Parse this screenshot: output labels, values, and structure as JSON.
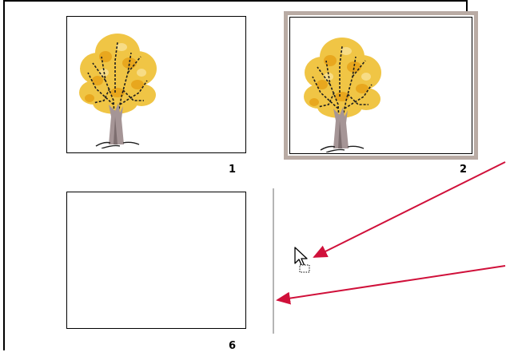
{
  "slides": [
    {
      "number": "1",
      "has_image": true,
      "selected": false,
      "image": "tree-autumn-illustration"
    },
    {
      "number": "2",
      "has_image": true,
      "selected": true,
      "image": "tree-autumn-illustration"
    },
    {
      "number": "6",
      "has_image": false,
      "selected": false
    }
  ],
  "drag": {
    "cursor_icon": "drag-arrow-cursor-icon",
    "insertion_marker": "insertion-line"
  },
  "annotations": {
    "arrow_color": "#d0103a",
    "arrows": [
      "callout-arrow-to-cursor",
      "callout-arrow-to-insertion-line"
    ]
  },
  "colors": {
    "selection_border": "#b9aba4",
    "insertion_line": "#b5b5b5"
  }
}
